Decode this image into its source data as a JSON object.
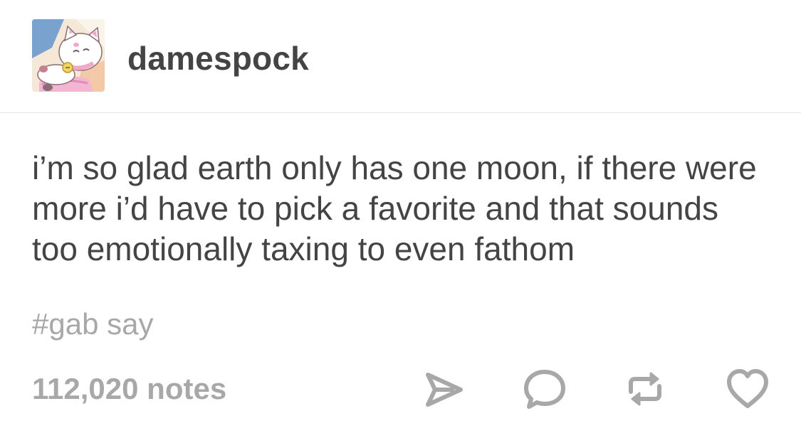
{
  "post": {
    "username": "damespock",
    "body": "i’m so glad earth only has one moon, if there were more i’d have to pick a favorite and that sounds too emotionally taxing to even fathom",
    "tags": [
      "#gab",
      "say"
    ],
    "notes": "112,020 notes"
  },
  "actions": {
    "share_icon": "share-arrow",
    "reply_icon": "speech-bubble",
    "reblog_icon": "reblog-arrows",
    "like_icon": "heart"
  },
  "colors": {
    "text": "#444444",
    "muted": "#a8a8a8",
    "divider": "#e6e6e6",
    "background": "#ffffff"
  }
}
